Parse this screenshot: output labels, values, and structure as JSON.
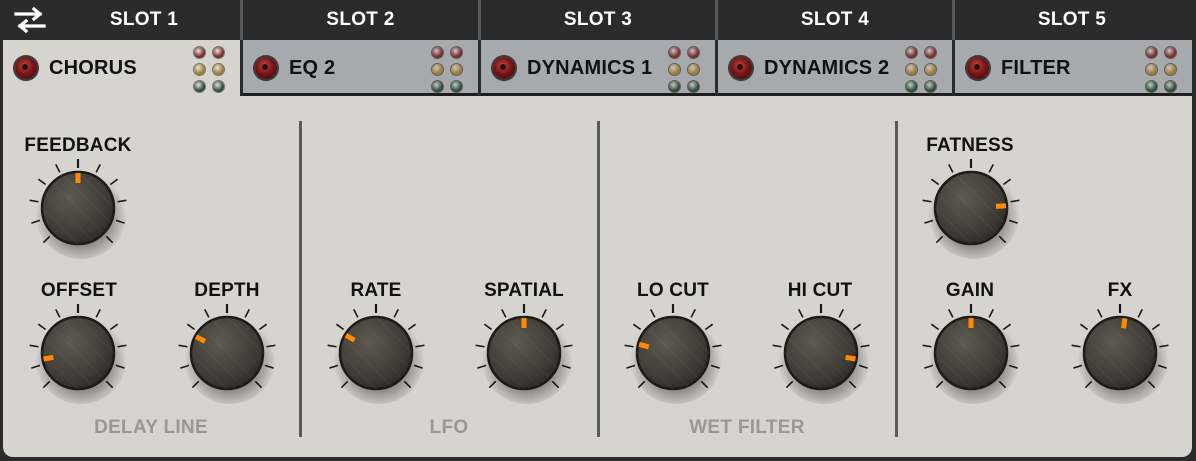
{
  "slots": [
    {
      "header": "SLOT 1",
      "module": "CHORUS",
      "active": true
    },
    {
      "header": "SLOT 2",
      "module": "EQ 2",
      "active": false
    },
    {
      "header": "SLOT 3",
      "module": "DYNAMICS 1",
      "active": false
    },
    {
      "header": "SLOT 4",
      "module": "DYNAMICS 2",
      "active": false
    },
    {
      "header": "SLOT 5",
      "module": "FILTER",
      "active": false
    }
  ],
  "knobs": {
    "feedback": {
      "label": "FEEDBACK",
      "value": 0.5
    },
    "offset": {
      "label": "OFFSET",
      "value": 0.13
    },
    "depth": {
      "label": "DEPTH",
      "value": 0.27
    },
    "rate": {
      "label": "RATE",
      "value": 0.28
    },
    "spatial": {
      "label": "SPATIAL",
      "value": 0.5
    },
    "lo_cut": {
      "label": "LO CUT",
      "value": 0.22
    },
    "hi_cut": {
      "label": "HI CUT",
      "value": 0.87
    },
    "fatness": {
      "label": "FATNESS",
      "value": 0.82
    },
    "gain": {
      "label": "GAIN",
      "value": 0.5
    },
    "fx": {
      "label": "FX",
      "value": 0.53
    }
  },
  "sections": {
    "delay_line": "DELAY LINE",
    "lfo": "LFO",
    "wet_filter": "WET FILTER"
  },
  "colors": {
    "indicator": "#ff8a00",
    "panel": "#d6d4cf",
    "header_bg": "#2b2b2b",
    "tab_inactive": "#a7aaac",
    "led_red": "#8a1a1a",
    "dot_red": "#7a2a2a",
    "dot_amber": "#9c7a32",
    "dot_green": "#2e4a38"
  },
  "icons": {
    "swap": "swap-arrows-icon"
  }
}
